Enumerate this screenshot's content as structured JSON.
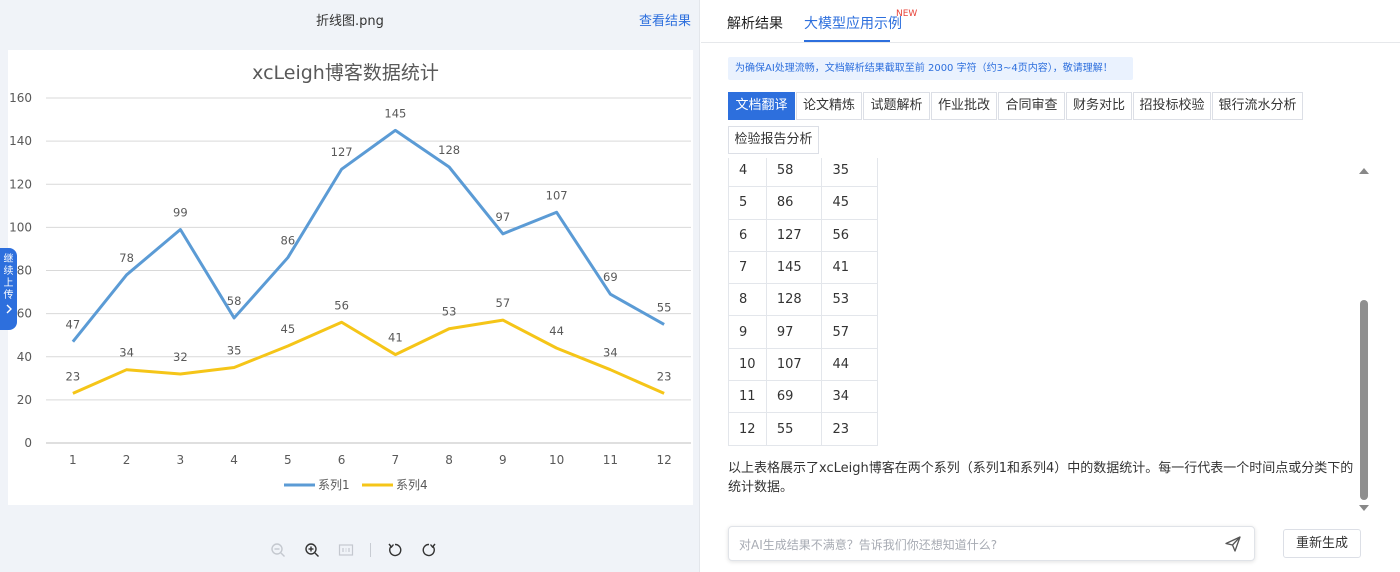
{
  "left_panel": {
    "file_name": "折线图.png",
    "view_result_label": "查看结果",
    "side_tab_label": "继续上传"
  },
  "right_panel": {
    "tabs": [
      {
        "label": "解析结果",
        "active": false
      },
      {
        "label": "大模型应用示例",
        "active": true
      }
    ],
    "new_badge": "NEW",
    "notice": "为确保AI处理流畅，文档解析结果截取至前 2000 字符（约3~4页内容），敬请理解！",
    "functions": [
      {
        "label": "文档翻译",
        "active": true
      },
      {
        "label": "论文精炼",
        "active": false
      },
      {
        "label": "试题解析",
        "active": false
      },
      {
        "label": "作业批改",
        "active": false
      },
      {
        "label": "合同审查",
        "active": false
      },
      {
        "label": "财务对比",
        "active": false
      },
      {
        "label": "招投标校验",
        "active": false
      },
      {
        "label": "银行流水分析",
        "active": false
      },
      {
        "label": "检验报告分析",
        "active": false
      }
    ],
    "table_rows": [
      [
        "4",
        "58",
        "35"
      ],
      [
        "5",
        "86",
        "45"
      ],
      [
        "6",
        "127",
        "56"
      ],
      [
        "7",
        "145",
        "41"
      ],
      [
        "8",
        "128",
        "53"
      ],
      [
        "9",
        "97",
        "57"
      ],
      [
        "10",
        "107",
        "44"
      ],
      [
        "11",
        "69",
        "34"
      ],
      [
        "12",
        "55",
        "23"
      ]
    ],
    "summary": "以上表格展示了xcLeigh博客在两个系列（系列1和系列4）中的数据统计。每一行代表一个时间点或分类下的统计数据。",
    "chat_placeholder": "对AI生成结果不满意？告诉我们你还想知道什么?",
    "regenerate_label": "重新生成"
  },
  "colors": {
    "accent": "#2d6fdd",
    "series1": "#5b9bd5",
    "series4": "#f5c518"
  },
  "chart_data": {
    "type": "line",
    "title": "xcLeigh博客数据统计",
    "categories": [
      "1",
      "2",
      "3",
      "4",
      "5",
      "6",
      "7",
      "8",
      "9",
      "10",
      "11",
      "12"
    ],
    "series": [
      {
        "name": "系列1",
        "values": [
          47,
          78,
          99,
          58,
          86,
          127,
          145,
          128,
          97,
          107,
          69,
          55
        ]
      },
      {
        "name": "系列4",
        "values": [
          23,
          34,
          32,
          35,
          45,
          56,
          41,
          53,
          57,
          44,
          34,
          23
        ]
      }
    ],
    "ylim": [
      0,
      160
    ],
    "yticks": [
      0,
      20,
      40,
      60,
      80,
      100,
      120,
      140,
      160
    ],
    "grid": true,
    "legend": "bottom"
  }
}
